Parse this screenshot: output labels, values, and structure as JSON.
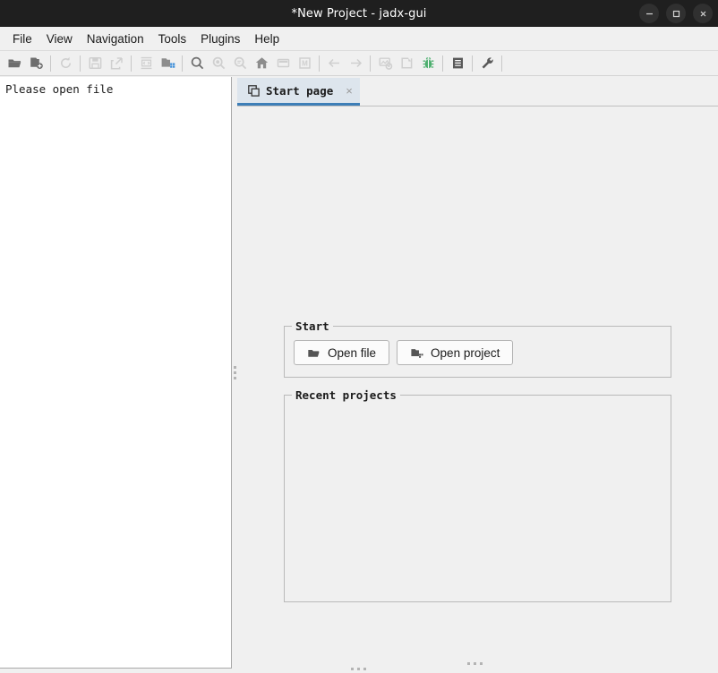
{
  "window": {
    "title": "*New Project - jadx-gui",
    "controls": [
      {
        "name": "minimize-button",
        "glyph": "minimize"
      },
      {
        "name": "maximize-button",
        "glyph": "maximize"
      },
      {
        "name": "close-button",
        "glyph": "close"
      }
    ]
  },
  "menubar": {
    "items": [
      {
        "label": "File"
      },
      {
        "label": "View"
      },
      {
        "label": "Navigation"
      },
      {
        "label": "Tools"
      },
      {
        "label": "Plugins"
      },
      {
        "label": "Help"
      }
    ]
  },
  "toolbar": {
    "items": [
      {
        "type": "button",
        "icon": "open-file-icon",
        "enabled": true
      },
      {
        "type": "button",
        "icon": "add-files-icon",
        "enabled": true
      },
      {
        "type": "separator"
      },
      {
        "type": "button",
        "icon": "reload-icon",
        "enabled": false
      },
      {
        "type": "separator"
      },
      {
        "type": "button",
        "icon": "save-all-icon",
        "enabled": false
      },
      {
        "type": "button",
        "icon": "export-icon",
        "enabled": false
      },
      {
        "type": "separator"
      },
      {
        "type": "button",
        "icon": "decompile-icon",
        "enabled": false
      },
      {
        "type": "button",
        "icon": "deobfuscation-icon",
        "enabled": true
      },
      {
        "type": "separator"
      },
      {
        "type": "button",
        "icon": "search-icon",
        "enabled": true
      },
      {
        "type": "button",
        "icon": "search-class-icon",
        "enabled": false
      },
      {
        "type": "button",
        "icon": "search-comment-icon",
        "enabled": false
      },
      {
        "type": "button",
        "icon": "main-activity-icon",
        "enabled": false
      },
      {
        "type": "button",
        "icon": "bookmarks-icon",
        "enabled": false
      },
      {
        "type": "button",
        "icon": "manifest-icon",
        "enabled": false
      },
      {
        "type": "separator"
      },
      {
        "type": "button",
        "icon": "back-arrow-icon",
        "enabled": false
      },
      {
        "type": "button",
        "icon": "forward-arrow-icon",
        "enabled": false
      },
      {
        "type": "separator"
      },
      {
        "type": "button",
        "icon": "quark-analysis-icon",
        "enabled": false
      },
      {
        "type": "button",
        "icon": "open-device-icon",
        "enabled": false
      },
      {
        "type": "button",
        "icon": "debugger-icon",
        "enabled": true
      },
      {
        "type": "separator"
      },
      {
        "type": "button",
        "icon": "log-viewer-icon",
        "enabled": true
      },
      {
        "type": "separator"
      },
      {
        "type": "button",
        "icon": "preferences-icon",
        "enabled": true
      },
      {
        "type": "separator"
      }
    ]
  },
  "left_panel": {
    "message": "Please open file"
  },
  "tabs": [
    {
      "label": "Start page",
      "icon": "start-page-icon",
      "close_glyph": "×",
      "active": true
    }
  ],
  "start_page": {
    "start_group": {
      "title": "Start",
      "buttons": [
        {
          "label": "Open file",
          "icon": "folder-open-icon"
        },
        {
          "label": "Open project",
          "icon": "project-icon"
        }
      ]
    },
    "recent_group": {
      "title": "Recent projects",
      "items": []
    }
  },
  "colors": {
    "titlebar_bg": "#1f1f1f",
    "chrome_bg": "#f0f0f0",
    "panel_bg": "#ffffff",
    "tab_active_bg": "#dde5ed",
    "tab_accent": "#3d7eb7",
    "border": "#b9b9b9",
    "icon_gray": "#808080",
    "icon_disabled": "#c8c8c8",
    "debugger_green": "#4caf6e"
  }
}
